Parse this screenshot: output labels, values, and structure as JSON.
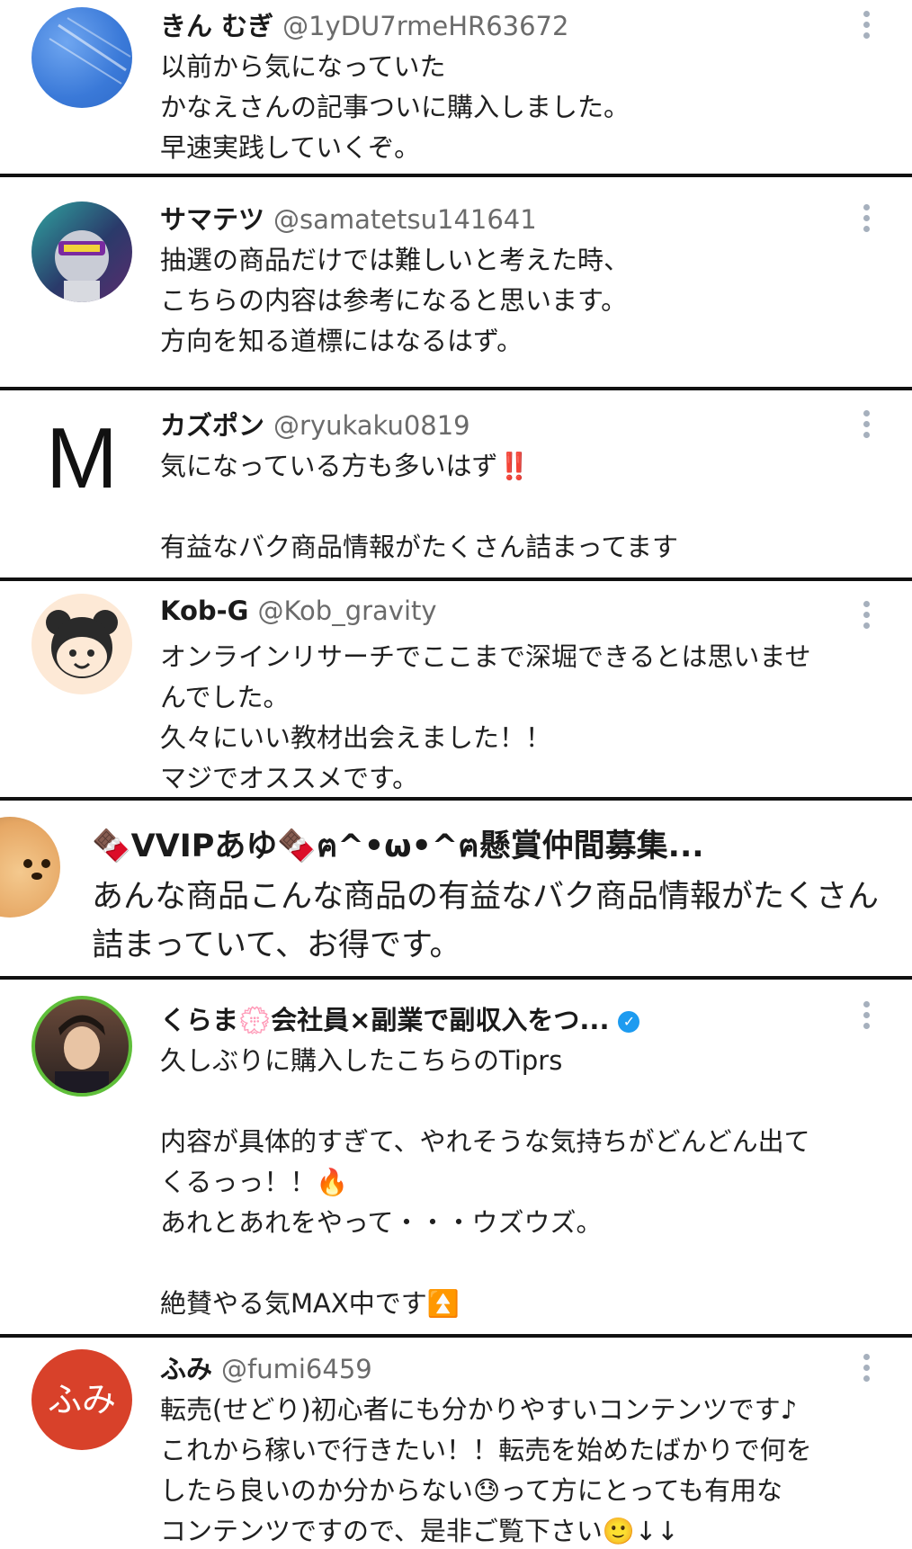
{
  "posts": [
    {
      "name": "きん むぎ",
      "handle": "@1yDU7rmeHR63672",
      "avatar_icon": "blue-circle-avatar",
      "body": "以前から気になっていた\nかなえさんの記事ついに購入しました。\n早速実践していくぞ。"
    },
    {
      "name": "サマテツ",
      "handle": "@samatetsu141641",
      "avatar_icon": "robot-avatar",
      "body": "抽選の商品だけでは難しいと考えた時、\nこちらの内容は参考になると思います。\n方向を知る道標にはなるはず。"
    },
    {
      "name": "カズポン",
      "handle": "@ryukaku0819",
      "avatar_letter": "M",
      "body": "気になっている方も多いはず‼️\n\n有益なバク商品情報がたくさん詰まってます"
    },
    {
      "name": "Kob-G",
      "handle": "@Kob_gravity",
      "avatar_icon": "bear-avatar",
      "body": "オンラインリサーチでここまで深堀できるとは思いませ\nんでした。\n久々にいい教材出会えました！！\nマジでオススメです。"
    },
    {
      "name": "🍫VVIPあゆ🍫ฅ^•ω•^ฅ懸賞仲間募集...",
      "avatar_icon": "dog-avatar",
      "body": "あんな商品こんな商品の有益なバク商品情報がたくさん\n詰まっていて、お得です。"
    },
    {
      "name": "くらま💮会社員×副業で副収入をつ...",
      "verified": "✓",
      "avatar_icon": "man-portrait-avatar",
      "body": "久しぶりに購入したこちらのTiprs\n\n内容が具体的すぎて、やれそうな気持ちがどんどん出て\nくるっっ！！🔥\nあれとあれをやって・・・ウズウズ。\n\n絶賛やる気MAX中です⏫"
    },
    {
      "name": "ふみ",
      "handle": "@fumi6459",
      "avatar_text": "ふみ",
      "body": "転売(せどり)初心者にも分かりやすいコンテンツです♪\nこれから稼いで行きたい！！転売を始めたばかりで何を\nしたら良いのか分からない😓って方にとっても有用な\nコンテンツですので、是非ご覧下さい🙂↓↓"
    }
  ],
  "colors": {
    "separator": "#111111",
    "handle": "#6b6b6b",
    "kebab": "#a6b0bd",
    "verified": "#1d9bf0",
    "fumi_avatar": "#d8412a"
  }
}
